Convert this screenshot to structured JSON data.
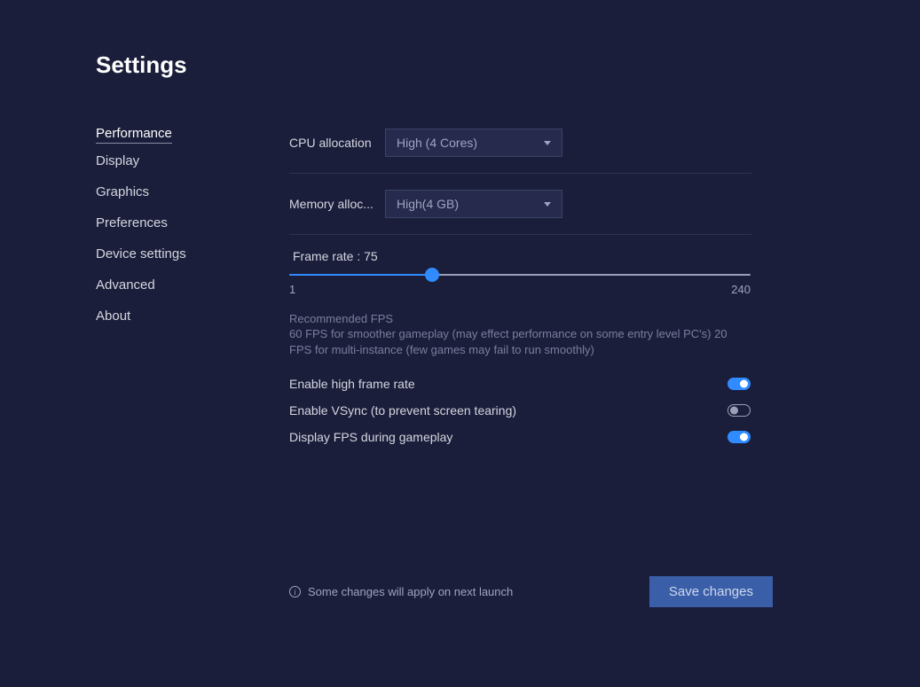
{
  "title": "Settings",
  "sidebar": {
    "items": [
      {
        "label": "Performance",
        "active": true
      },
      {
        "label": "Display",
        "active": false
      },
      {
        "label": "Graphics",
        "active": false
      },
      {
        "label": "Preferences",
        "active": false
      },
      {
        "label": "Device settings",
        "active": false
      },
      {
        "label": "Advanced",
        "active": false
      },
      {
        "label": "About",
        "active": false
      }
    ]
  },
  "cpu": {
    "label": "CPU allocation",
    "value": "High (4 Cores)"
  },
  "memory": {
    "label": "Memory alloc...",
    "value": "High(4 GB)"
  },
  "framerate": {
    "label_prefix": "Frame rate : ",
    "value": 75,
    "min": 1,
    "max": 240,
    "hint_title": "Recommended FPS",
    "hint_text": "60 FPS for smoother gameplay (may effect performance on some entry level PC's) 20 FPS for multi-instance (few games may fail to run smoothly)"
  },
  "toggles": {
    "high_frame": {
      "label": "Enable high frame rate",
      "on": true
    },
    "vsync": {
      "label": "Enable VSync (to prevent screen tearing)",
      "on": false
    },
    "display_fps": {
      "label": "Display FPS during gameplay",
      "on": true
    }
  },
  "footer": {
    "info": "Some changes will apply on next launch",
    "save_label": "Save changes"
  }
}
